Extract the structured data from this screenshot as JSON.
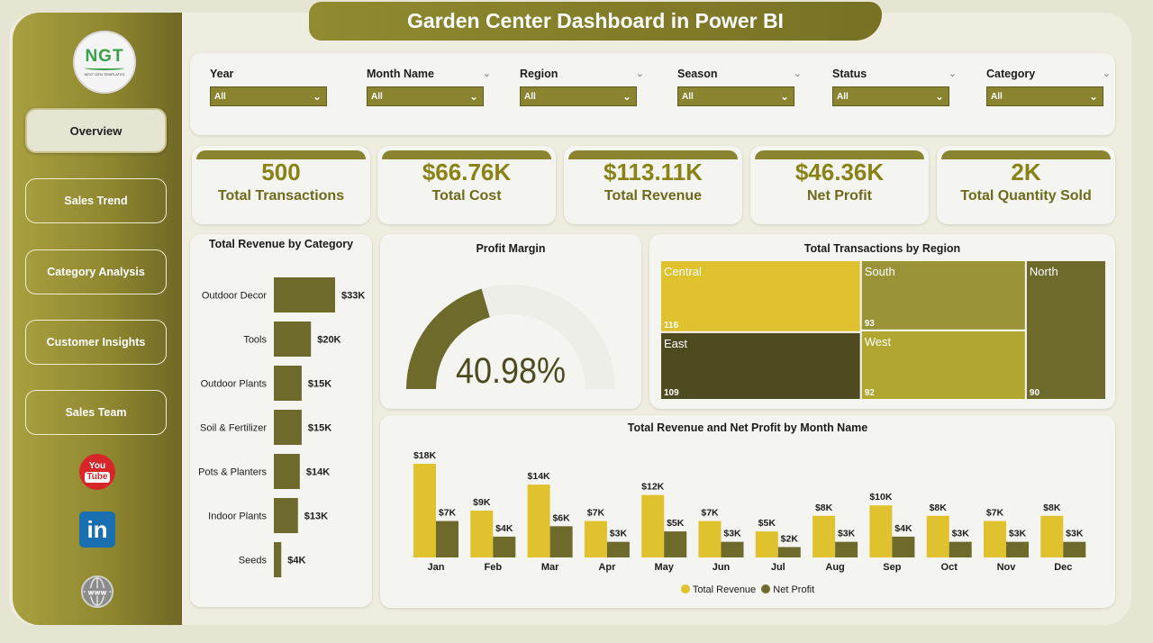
{
  "title": "Garden Center Dashboard in Power BI",
  "logo": {
    "text": "NGT",
    "tagline": "NEXT GEN TEMPLATES"
  },
  "nav": [
    {
      "label": "Overview",
      "active": true
    },
    {
      "label": "Sales Trend",
      "active": false
    },
    {
      "label": "Category Analysis",
      "active": false
    },
    {
      "label": "Customer Insights",
      "active": false
    },
    {
      "label": "Sales Team",
      "active": false
    }
  ],
  "social": {
    "youtube": "You Tube",
    "linkedin": "in",
    "website": "www"
  },
  "filters": [
    {
      "label": "Year",
      "value": "All"
    },
    {
      "label": "Month Name",
      "value": "All"
    },
    {
      "label": "Region",
      "value": "All"
    },
    {
      "label": "Season",
      "value": "All"
    },
    {
      "label": "Status",
      "value": "All"
    },
    {
      "label": "Category",
      "value": "All"
    }
  ],
  "kpis": [
    {
      "value": "500",
      "label": "Total Transactions"
    },
    {
      "value": "$66.76K",
      "label": "Total Cost"
    },
    {
      "value": "$113.11K",
      "label": "Total Revenue"
    },
    {
      "value": "$46.36K",
      "label": "Net Profit"
    },
    {
      "value": "2K",
      "label": "Total Quantity Sold"
    }
  ],
  "colors": {
    "accent": "#8a8430",
    "gold": "#e0c12e",
    "olive": "#6e6a2c",
    "dark": "#4d4a1f"
  },
  "chart_data": [
    {
      "type": "bar",
      "orientation": "horizontal",
      "title": "Total Revenue by Category",
      "categories": [
        "Outdoor Decor",
        "Tools",
        "Outdoor Plants",
        "Soil & Fertilizer",
        "Pots & Planters",
        "Indoor Plants",
        "Seeds"
      ],
      "values": [
        33,
        20,
        15,
        15,
        14,
        13,
        4
      ],
      "data_labels": [
        "$33K",
        "$20K",
        "$15K",
        "$15K",
        "$14K",
        "$13K",
        "$4K"
      ],
      "unit": "K$"
    },
    {
      "type": "gauge",
      "title": "Profit Margin",
      "value": 40.98,
      "display": "40.98%",
      "range": [
        0,
        100
      ]
    },
    {
      "type": "treemap",
      "title": "Total Transactions by Region",
      "categories": [
        "Central",
        "South",
        "North",
        "East",
        "West"
      ],
      "values": [
        116,
        93,
        90,
        109,
        92
      ]
    },
    {
      "type": "bar",
      "title": "Total Revenue and Net Profit by Month Name",
      "categories": [
        "Jan",
        "Feb",
        "Mar",
        "Apr",
        "May",
        "Jun",
        "Jul",
        "Aug",
        "Sep",
        "Oct",
        "Nov",
        "Dec"
      ],
      "series": [
        {
          "name": "Total Revenue",
          "values": [
            18,
            9,
            14,
            7,
            12,
            7,
            5,
            8,
            10,
            8,
            7,
            8
          ],
          "labels": [
            "$18K",
            "$9K",
            "$14K",
            "$7K",
            "$12K",
            "$7K",
            "$5K",
            "$8K",
            "$10K",
            "$8K",
            "$7K",
            "$8K"
          ]
        },
        {
          "name": "Net Profit",
          "values": [
            7,
            4,
            6,
            3,
            5,
            3,
            2,
            3,
            4,
            3,
            3,
            3
          ],
          "labels": [
            "$7K",
            "$4K",
            "$6K",
            "$3K",
            "$5K",
            "$3K",
            "$2K",
            "$3K",
            "$4K",
            "$3K",
            "$3K",
            "$3K"
          ]
        }
      ],
      "legend": "bottom-center"
    }
  ]
}
